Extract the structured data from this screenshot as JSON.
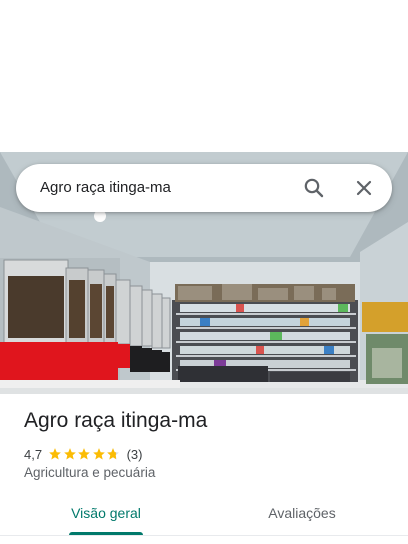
{
  "search": {
    "query": "Agro raça itinga-ma",
    "search_icon": "search-icon",
    "close_icon": "close-icon"
  },
  "place": {
    "name": "Agro raça itinga-ma",
    "rating": 4.7,
    "rating_text": "4,7",
    "reviews_count_text": "(3)",
    "category": "Agricultura e pecuária"
  },
  "tabs": [
    {
      "label": "Visão geral",
      "active": true
    },
    {
      "label": "Avaliações",
      "active": false
    }
  ],
  "colors": {
    "accent": "#00796b",
    "star": "#fbbc04",
    "dispenser_red": "#e0151d"
  }
}
